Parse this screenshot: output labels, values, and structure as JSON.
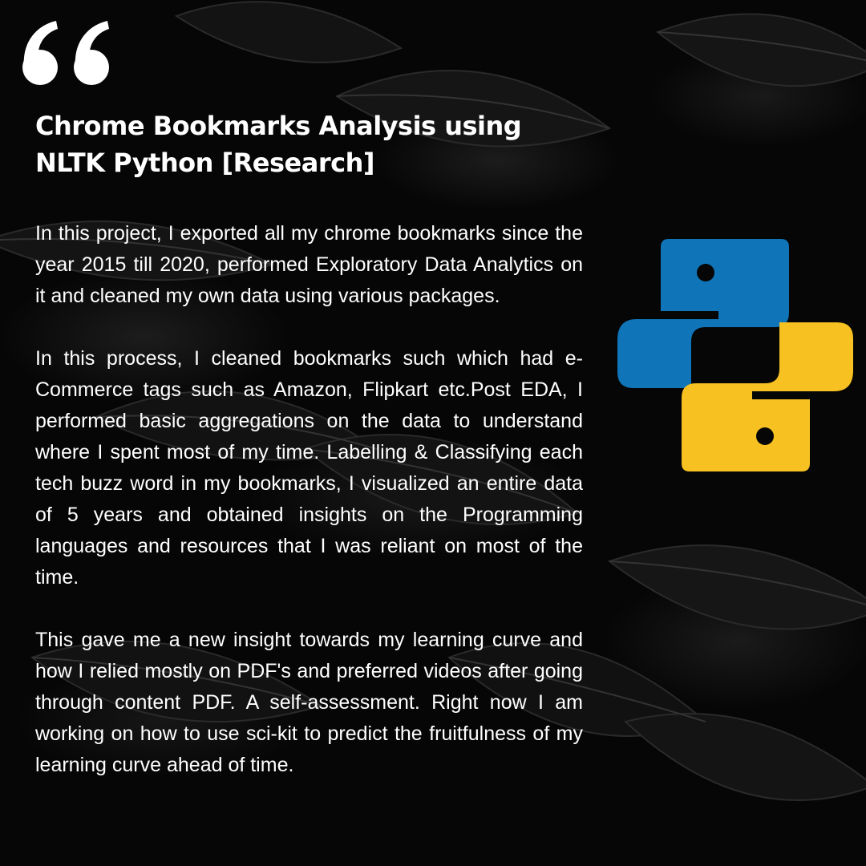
{
  "post": {
    "title_line1": "Chrome Bookmarks Analysis using",
    "title_line2": "NLTK Python [Research]",
    "paragraphs": [
      "In this project, I exported all my chrome bookmarks since the year 2015 till 2020, performed Exploratory Data Analytics on it and cleaned my own data using various packages.",
      "In this process, I cleaned bookmarks such which had e-Commerce tags such as Amazon, Flipkart etc.Post EDA, I performed basic aggregations on the data to understand where I spent most of my time. Labelling & Classifying each tech buzz word in my bookmarks, I visualized an entire data of 5 years and obtained insights on the Programming languages and resources that I was reliant on most of the time.",
      "This gave me a new insight towards my learning curve and how I relied mostly on PDF's and preferred videos after going through content PDF. A self-assessment. Right now I am working on how to use sci-kit to predict the fruitfulness of my learning curve ahead of time."
    ]
  },
  "icons": {
    "quote": "quote-icon",
    "logo": "python-logo-icon"
  },
  "colors": {
    "background": "#060606",
    "text": "#ffffff",
    "python_blue": "#0f74b8",
    "python_yellow": "#f7c121"
  }
}
